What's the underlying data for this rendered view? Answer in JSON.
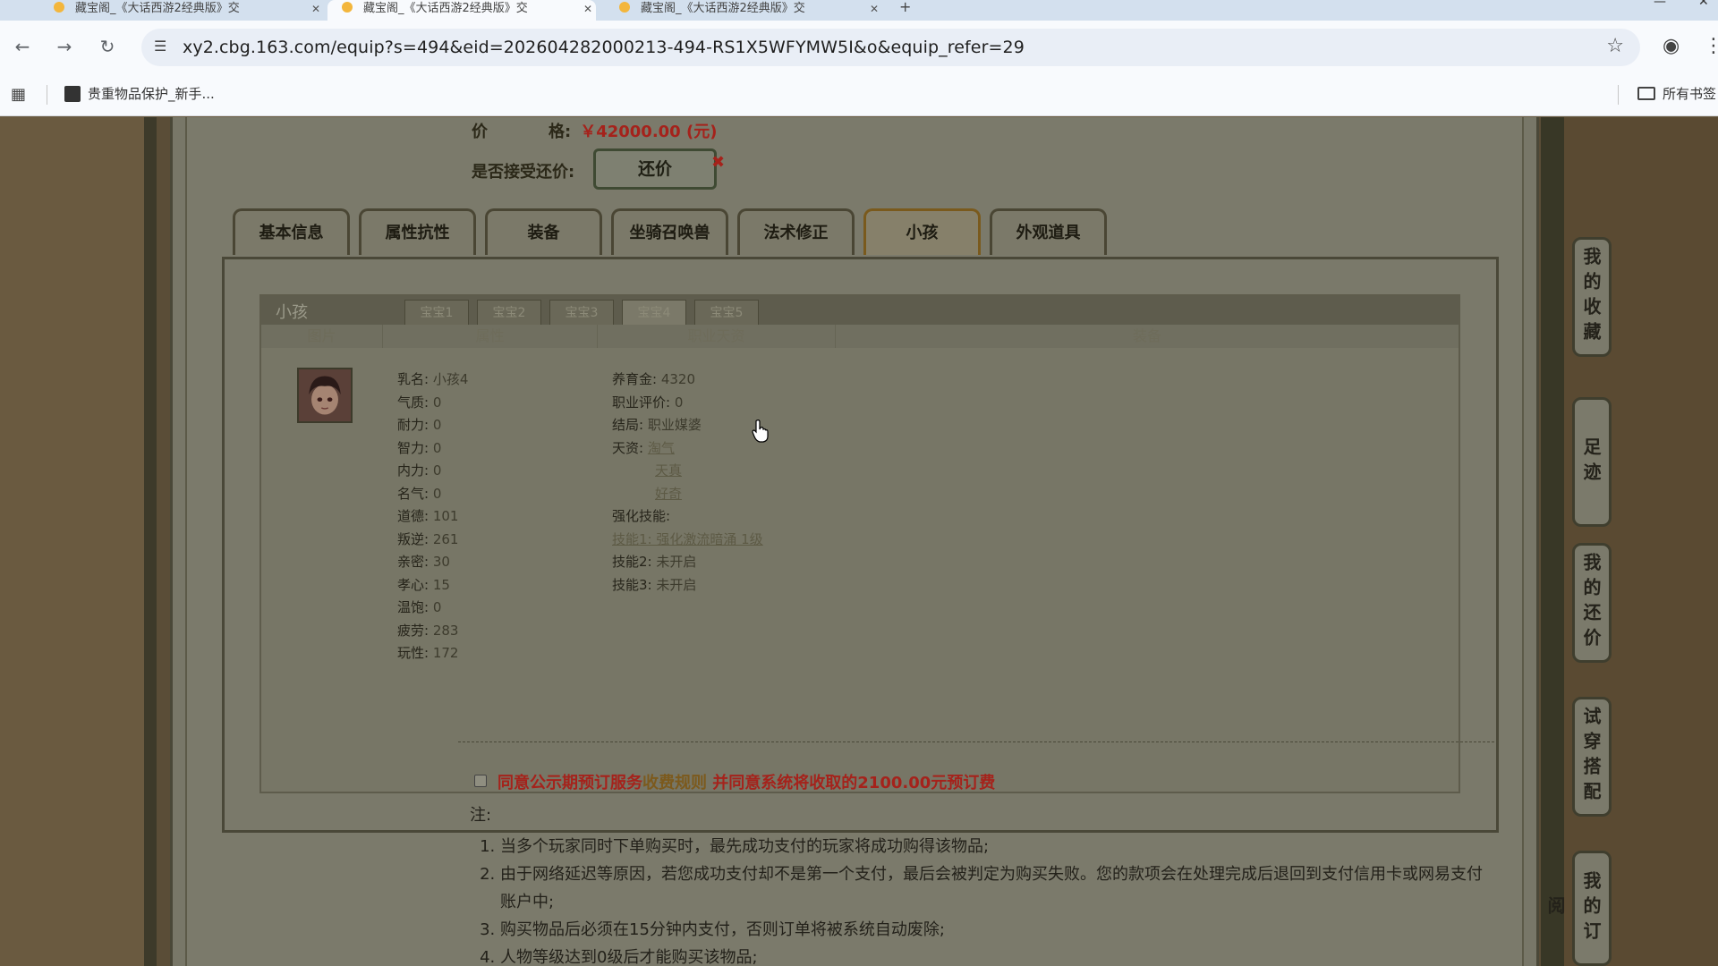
{
  "browser": {
    "tabs": [
      {
        "title": "藏宝阁_《大话西游2经典版》交"
      },
      {
        "title": "藏宝阁_《大话西游2经典版》交"
      },
      {
        "title": "藏宝阁_《大话西游2经典版》交"
      }
    ],
    "new_tab": "+",
    "url": "xy2.cbg.163.com/equip?s=494&eid=202604282000213-494-RS1X5WFYMW5I&o&equip_refer=29",
    "bookmark_item": "贵重物品保护_新手...",
    "all_bookmarks": "所有书签"
  },
  "price": {
    "label_a": "价",
    "label_b": "格:",
    "value": "￥42000.00 (元)"
  },
  "bargain": {
    "label": "是否接受还价:",
    "button": "还价",
    "close": "✖"
  },
  "main_tabs": [
    {
      "label": "基本信息"
    },
    {
      "label": "属性抗性"
    },
    {
      "label": "装备"
    },
    {
      "label": "坐骑召唤兽"
    },
    {
      "label": "法术修正"
    },
    {
      "label": "小孩"
    },
    {
      "label": "外观道具"
    }
  ],
  "kid_panel": {
    "title": "小孩",
    "subtabs": [
      "宝宝1",
      "宝宝2",
      "宝宝3",
      "宝宝4",
      "宝宝5"
    ],
    "columns": [
      "图片",
      "属性",
      "职业天资",
      "装备"
    ],
    "attributes": [
      {
        "k": "乳名:",
        "v": "小孩4"
      },
      {
        "k": "气质:",
        "v": "0"
      },
      {
        "k": "耐力:",
        "v": "0"
      },
      {
        "k": "智力:",
        "v": "0"
      },
      {
        "k": "内力:",
        "v": "0"
      },
      {
        "k": "名气:",
        "v": "0"
      },
      {
        "k": "道德:",
        "v": "101"
      },
      {
        "k": "叛逆:",
        "v": "261"
      },
      {
        "k": "亲密:",
        "v": "30"
      },
      {
        "k": "孝心:",
        "v": "15"
      },
      {
        "k": "温饱:",
        "v": "0"
      },
      {
        "k": "疲劳:",
        "v": "283"
      },
      {
        "k": "玩性:",
        "v": "172"
      }
    ],
    "job": {
      "fund_k": "养育金:",
      "fund_v": "4320",
      "eval_k": "职业评价:",
      "eval_v": "0",
      "ending_k": "结局:",
      "ending_v": "职业媒婆",
      "talent_k": "天资:",
      "talents": [
        "淘气",
        "天真",
        "好奇"
      ],
      "skill_head": "强化技能:",
      "skill1": "技能1: 强化激流暗涌 1级",
      "skill2_k": "技能2:",
      "skill2_v": "未开启",
      "skill3_k": "技能3:",
      "skill3_v": "未开启"
    }
  },
  "agreement": {
    "text_a": "同意公示期预订服务",
    "link": "收费规则",
    "text_b": " 并同意系统将收取的2100.00元预订费"
  },
  "notes": {
    "heading": "注:",
    "items": [
      "当多个玩家同时下单购买时，最先成功支付的玩家将成功购得该物品;",
      "由于网络延迟等原因，若您成功支付却不是第一个支付，最后会被判定为购买失败。您的款项会在处理完成后退回到支付信用卡或网易支付账户中;",
      "购买物品后必须在15分钟内支付，否则订单将被系统自动废除;",
      "人物等级达到0级后才能购买该物品;"
    ]
  },
  "side_menu": [
    "我的收藏",
    "足迹",
    "我的还价",
    "试穿搭配",
    "我的订阅"
  ]
}
